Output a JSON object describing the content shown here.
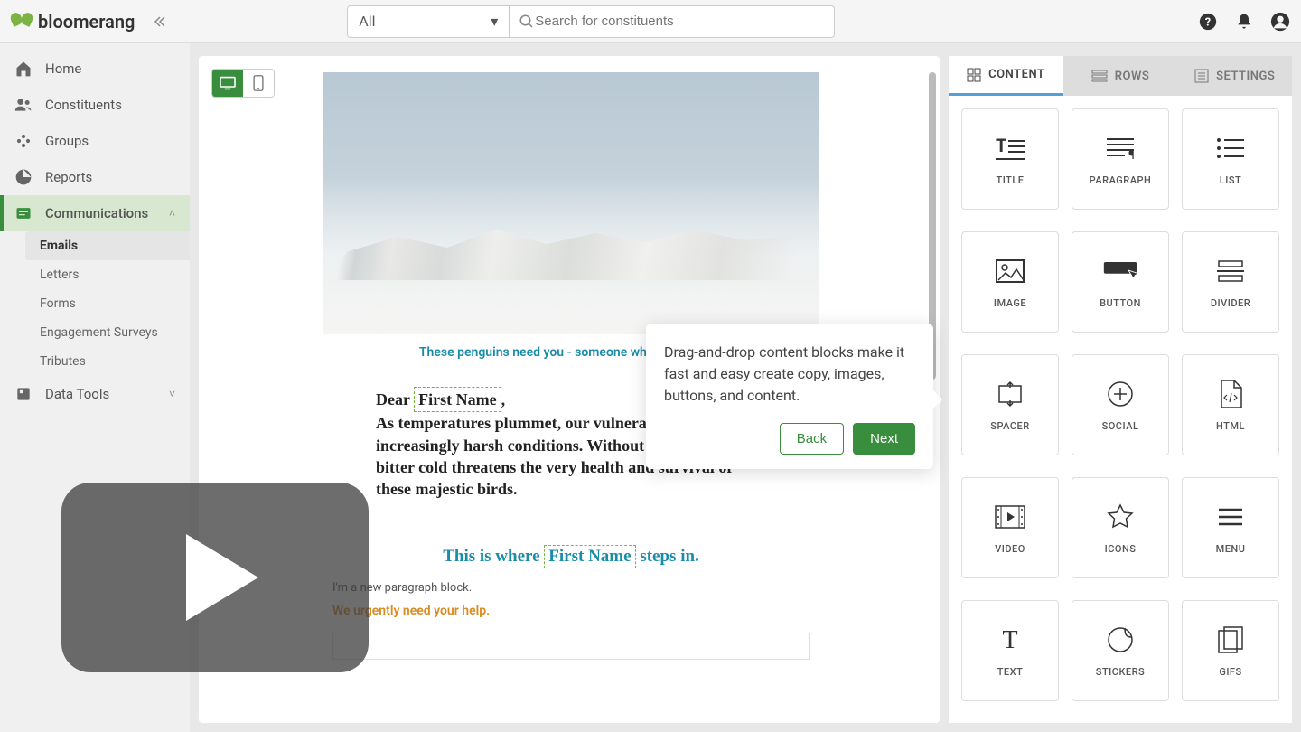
{
  "brand": "bloomerang",
  "search": {
    "filter": "All",
    "placeholder": "Search for constituents"
  },
  "sidebar": {
    "items": [
      {
        "label": "Home"
      },
      {
        "label": "Constituents"
      },
      {
        "label": "Groups"
      },
      {
        "label": "Reports"
      },
      {
        "label": "Communications"
      },
      {
        "label": "Data Tools"
      }
    ],
    "comms_sub": [
      {
        "label": "Emails"
      },
      {
        "label": "Letters"
      },
      {
        "label": "Forms"
      },
      {
        "label": "Engagement Surveys"
      },
      {
        "label": "Tributes"
      }
    ]
  },
  "email": {
    "tagline": "These penguins need you - someone who loves them.",
    "greeting_prefix": "Dear ",
    "merge_first_name": "First Name",
    "greeting_suffix": ",",
    "body": "As temperatures plummet, our vulnerable penguins face increasingly harsh conditions. Without your help, the bitter cold threatens the very health and survival of these majestic birds.",
    "subhead_before": "This is where ",
    "subhead_after": " steps in.",
    "new_para": "I'm a new paragraph block.",
    "urgent": "We urgently need your help."
  },
  "panel": {
    "tabs": [
      "CONTENT",
      "ROWS",
      "SETTINGS"
    ],
    "blocks": [
      "TITLE",
      "PARAGRAPH",
      "LIST",
      "IMAGE",
      "BUTTON",
      "DIVIDER",
      "SPACER",
      "SOCIAL",
      "HTML",
      "VIDEO",
      "ICONS",
      "MENU",
      "TEXT",
      "STICKERS",
      "GIFS"
    ]
  },
  "tooltip": {
    "text": "Drag-and-drop content blocks make it fast and easy create copy, images, buttons, and content.",
    "back": "Back",
    "next": "Next"
  },
  "colors": {
    "accent": "#388e3c",
    "link": "#1a8ca8",
    "warn": "#d88b1f"
  }
}
